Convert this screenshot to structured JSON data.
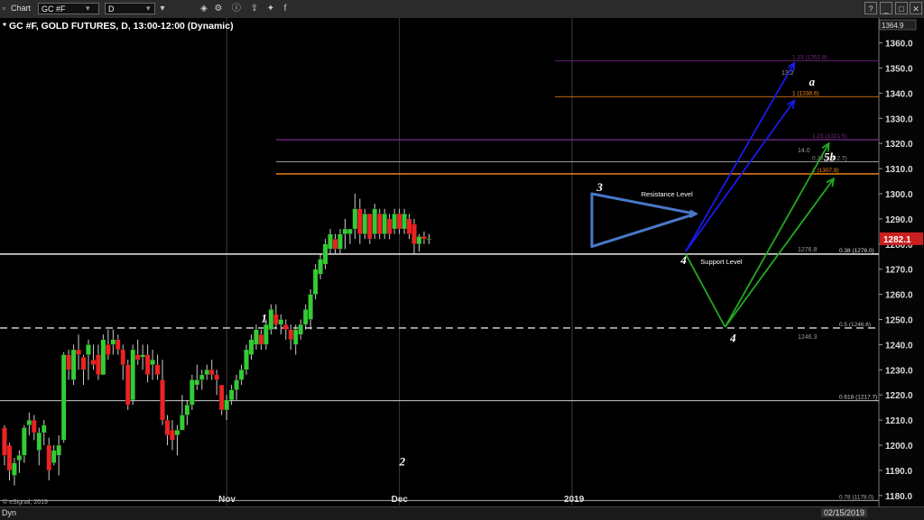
{
  "window": {
    "title": "Chart",
    "symbol": "GC #F",
    "interval": "D",
    "chart_title": "GC #F, GOLD FUTURES, D, 13:00-12:00 (Dynamic)",
    "top_price_label": "1364.9",
    "current_price_label": "1282.1",
    "copyright": "© eSignal, 2019",
    "mode_label": "Dyn",
    "date_label": "02/15/2019"
  },
  "toolbar": {
    "icons": [
      "settings-icon",
      "info-icon",
      "share-icon",
      "twitter-icon",
      "facebook-icon"
    ]
  },
  "colors": {
    "background": "#000000",
    "up_candle": "#33cc33",
    "down_candle": "#ee2222",
    "blue_arrow": "#1a1aee",
    "green_arrow": "#22aa22",
    "triangle": "#4a78c8",
    "fib_orange": "#ff8c1a",
    "fib_purple": "#7a2a8a"
  },
  "chart_data": {
    "type": "candlestick",
    "title": "GC #F, GOLD FUTURES, D, 13:00-12:00 (Dynamic)",
    "ylim": [
      1176,
      1367
    ],
    "y_ticks": [
      1180,
      1190,
      1200,
      1210,
      1220,
      1230,
      1240,
      1250,
      1260,
      1270,
      1280,
      1290,
      1300,
      1310,
      1320,
      1330,
      1340,
      1350,
      1360
    ],
    "x_labels": [
      {
        "text": "Nov",
        "bar": 45
      },
      {
        "text": "Dec",
        "bar": 80
      },
      {
        "text": "2019",
        "bar": 115
      }
    ],
    "candles": [
      [
        1208,
        1192,
        1207,
        1196
      ],
      [
        1201,
        1186,
        1200,
        1190
      ],
      [
        1195,
        1184,
        1188,
        1193
      ],
      [
        1198,
        1189,
        1194,
        1196
      ],
      [
        1208,
        1193,
        1196,
        1207
      ],
      [
        1213,
        1204,
        1208,
        1210
      ],
      [
        1212,
        1202,
        1210,
        1205
      ],
      [
        1207,
        1192,
        1198,
        1205
      ],
      [
        1210,
        1200,
        1205,
        1208
      ],
      [
        1203,
        1186,
        1200,
        1190
      ],
      [
        1200,
        1192,
        1193,
        1198
      ],
      [
        1204,
        1188,
        1196,
        1200
      ],
      [
        1237,
        1201,
        1202,
        1236
      ],
      [
        1238,
        1226,
        1236,
        1230
      ],
      [
        1240,
        1224,
        1226,
        1238
      ],
      [
        1244,
        1230,
        1238,
        1236
      ],
      [
        1236,
        1224,
        1235,
        1230
      ],
      [
        1242,
        1226,
        1236,
        1240
      ],
      [
        1240,
        1230,
        1234,
        1232
      ],
      [
        1240,
        1226,
        1236,
        1228
      ],
      [
        1244,
        1228,
        1228,
        1242
      ],
      [
        1246,
        1234,
        1240,
        1236
      ],
      [
        1246,
        1236,
        1240,
        1242
      ],
      [
        1244,
        1236,
        1242,
        1238
      ],
      [
        1240,
        1226,
        1238,
        1232
      ],
      [
        1234,
        1214,
        1232,
        1216
      ],
      [
        1240,
        1216,
        1218,
        1238
      ],
      [
        1242,
        1232,
        1236,
        1234
      ],
      [
        1240,
        1230,
        1235,
        1236
      ],
      [
        1240,
        1225,
        1236,
        1228
      ],
      [
        1238,
        1226,
        1232,
        1234
      ],
      [
        1236,
        1226,
        1232,
        1228
      ],
      [
        1234,
        1208,
        1226,
        1210
      ],
      [
        1212,
        1200,
        1210,
        1204
      ],
      [
        1210,
        1198,
        1206,
        1202
      ],
      [
        1208,
        1196,
        1204,
        1206
      ],
      [
        1220,
        1206,
        1206,
        1212
      ],
      [
        1218,
        1208,
        1212,
        1216
      ],
      [
        1228,
        1214,
        1216,
        1226
      ],
      [
        1232,
        1222,
        1224,
        1226
      ],
      [
        1230,
        1222,
        1226,
        1228
      ],
      [
        1232,
        1226,
        1228,
        1230
      ],
      [
        1234,
        1226,
        1230,
        1228
      ],
      [
        1230,
        1220,
        1228,
        1226
      ],
      [
        1224,
        1212,
        1224,
        1214
      ],
      [
        1220,
        1210,
        1214,
        1218
      ],
      [
        1224,
        1216,
        1218,
        1222
      ],
      [
        1228,
        1218,
        1222,
        1226
      ],
      [
        1232,
        1224,
        1226,
        1230
      ],
      [
        1240,
        1228,
        1230,
        1238
      ],
      [
        1244,
        1234,
        1236,
        1242
      ],
      [
        1248,
        1238,
        1240,
        1246
      ],
      [
        1246,
        1238,
        1244,
        1240
      ],
      [
        1250,
        1238,
        1240,
        1248
      ],
      [
        1256,
        1244,
        1246,
        1254
      ],
      [
        1256,
        1246,
        1252,
        1248
      ],
      [
        1252,
        1244,
        1248,
        1250
      ],
      [
        1250,
        1242,
        1248,
        1246
      ],
      [
        1248,
        1238,
        1246,
        1242
      ],
      [
        1248,
        1236,
        1240,
        1246
      ],
      [
        1250,
        1242,
        1244,
        1248
      ],
      [
        1256,
        1246,
        1248,
        1254
      ],
      [
        1262,
        1246,
        1250,
        1260
      ],
      [
        1272,
        1258,
        1260,
        1270
      ],
      [
        1276,
        1266,
        1268,
        1274
      ],
      [
        1282,
        1270,
        1272,
        1280
      ],
      [
        1286,
        1276,
        1278,
        1284
      ],
      [
        1284,
        1276,
        1282,
        1278
      ],
      [
        1286,
        1276,
        1278,
        1284
      ],
      [
        1290,
        1278,
        1284,
        1286
      ],
      [
        1286,
        1280,
        1284,
        1286
      ],
      [
        1300,
        1282,
        1286,
        1294
      ],
      [
        1298,
        1280,
        1294,
        1284
      ],
      [
        1294,
        1282,
        1284,
        1292
      ],
      [
        1292,
        1280,
        1292,
        1282
      ],
      [
        1296,
        1282,
        1284,
        1294
      ],
      [
        1294,
        1282,
        1292,
        1284
      ],
      [
        1294,
        1282,
        1284,
        1292
      ],
      [
        1292,
        1282,
        1290,
        1284
      ],
      [
        1294,
        1284,
        1286,
        1292
      ],
      [
        1294,
        1284,
        1292,
        1286
      ],
      [
        1294,
        1284,
        1286,
        1292
      ],
      [
        1292,
        1282,
        1290,
        1284
      ],
      [
        1290,
        1276,
        1288,
        1280
      ],
      [
        1284,
        1277,
        1280,
        1283
      ],
      [
        1285,
        1280,
        1283,
        1282
      ],
      [
        1284,
        1280,
        1282,
        1282
      ]
    ],
    "horizontal_lines": [
      {
        "price": 1276.0,
        "style": "solid",
        "color": "#ffffff",
        "label": "0.38 (1276.0)",
        "extra_label": "1276.8",
        "width": 1.4
      },
      {
        "price": 1246.6,
        "style": "dashed",
        "color": "#bbbbbb",
        "label": "0.5 (1246.6)",
        "extra_label": "1246.3",
        "width": 1.6
      },
      {
        "price": 1217.7,
        "style": "solid",
        "color": "#cccccc",
        "label": "0.618 (1217.7)",
        "extra_label": "",
        "width": 1
      },
      {
        "price": 1178.0,
        "style": "solid",
        "color": "#aaaaaa",
        "label": "0.78 (1178.0)",
        "extra_label": "",
        "width": 1
      },
      {
        "price": 1312.7,
        "style": "solid",
        "color": "#999999",
        "label": "0.23 (1312.7)",
        "extra_label": "",
        "width": 1
      },
      {
        "price": 1307.9,
        "style": "solid",
        "color": "#ff8c1a",
        "label": "1 (1307.9)",
        "extra_label": "",
        "width": 1.4
      },
      {
        "price": 1321.5,
        "style": "solid",
        "color": "#7a2a8a",
        "label": "1.23 (1321.5)",
        "extra_label": "",
        "width": 1.2
      },
      {
        "price": 1338.6,
        "style": "solid",
        "color": "#ff8c1a",
        "label": "1 (1338.6)",
        "extra_label": "",
        "width": 0.8
      },
      {
        "price": 1352.8,
        "style": "solid",
        "color": "#7a2a8a",
        "label": "1.23 (1352.8)",
        "extra_label": "",
        "width": 0.8
      }
    ],
    "small_labels": [
      "14.0",
      "13.2"
    ],
    "wave_labels": [
      {
        "text": "1",
        "bar": 52,
        "price": 1249
      },
      {
        "text": "2",
        "bar": 80,
        "price": 1192
      },
      {
        "text": "3",
        "bar": 120,
        "price": 1301
      },
      {
        "text": "4",
        "bar": 137,
        "price": 1272
      },
      {
        "text": "4",
        "bar": 147,
        "price": 1241
      },
      {
        "text": "5b",
        "bar": 166,
        "price": 1313
      },
      {
        "text": "a",
        "bar": 163,
        "price": 1343
      }
    ],
    "annotations": [
      {
        "text": "Resistance Level",
        "bar": 129,
        "price": 1299
      },
      {
        "text": "Support Level",
        "bar": 141,
        "price": 1272
      }
    ],
    "arrows": [
      {
        "color": "blue",
        "from": [
          138,
          1277
        ],
        "to": [
          160,
          1352
        ]
      },
      {
        "color": "blue",
        "from": [
          138,
          1277
        ],
        "to": [
          160,
          1337
        ]
      },
      {
        "color": "green",
        "from": [
          138,
          1276
        ],
        "to": [
          146,
          1247
        ]
      },
      {
        "color": "green",
        "from": [
          146,
          1247
        ],
        "to": [
          167,
          1320
        ]
      },
      {
        "color": "green",
        "from": [
          146,
          1247
        ],
        "to": [
          168,
          1306
        ]
      }
    ],
    "triangle": {
      "apex": [
        140,
        1292
      ],
      "top": [
        119,
        1300
      ],
      "bottom": [
        119,
        1279
      ]
    }
  }
}
